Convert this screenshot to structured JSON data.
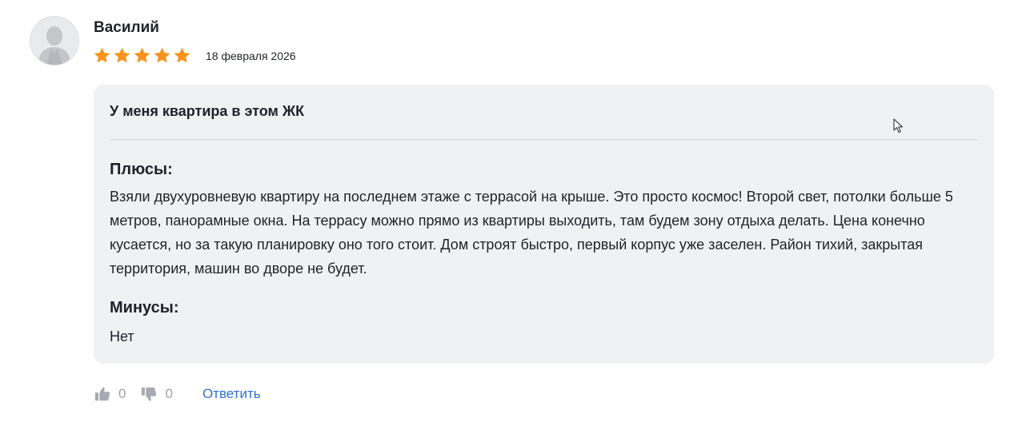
{
  "review": {
    "author": "Василий",
    "rating": 5,
    "rating_max": 5,
    "date": "18 февраля 2026",
    "title": "У меня квартира в этом ЖК",
    "pros_heading": "Плюсы:",
    "pros_text": "Взяли двухуровневую квартиру на последнем этаже с террасой на крыше. Это просто космос! Второй свет, потолки больше 5 метров, панорамные окна. На террасу можно прямо из квартиры выходить, там будем зону отдыха делать. Цена конечно кусается, но за такую планировку оно того стоит. Дом строят быстро, первый корпус уже заселен. Район тихий, закрытая территория, машин во дворе не будет.",
    "cons_heading": "Минусы:",
    "cons_text": "Нет"
  },
  "actions": {
    "likes": "0",
    "dislikes": "0",
    "reply_label": "Ответить"
  },
  "icons": {
    "avatar": "user-silhouette-icon",
    "star": "star-icon",
    "like": "thumbs-up-icon",
    "dislike": "thumbs-down-icon",
    "cursor": "mouse-pointer-icon"
  },
  "colors": {
    "star": "#f7931e",
    "card_background": "#f0f1f3",
    "link": "#2f6fd6",
    "muted": "#9ea2a9"
  }
}
